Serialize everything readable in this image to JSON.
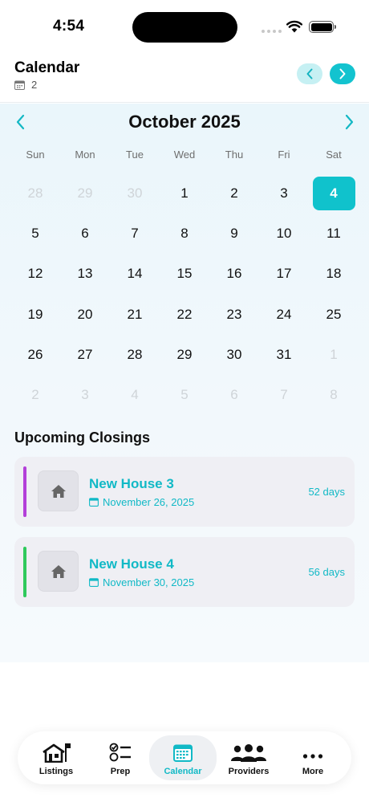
{
  "status_bar": {
    "time": "4:54"
  },
  "header": {
    "title": "Calendar",
    "count": "2"
  },
  "calendar": {
    "month_title": "October 2025",
    "weekdays": [
      "Sun",
      "Mon",
      "Tue",
      "Wed",
      "Thu",
      "Fri",
      "Sat"
    ],
    "selected_day": "4",
    "weeks": [
      [
        {
          "d": "28",
          "out": true
        },
        {
          "d": "29",
          "out": true
        },
        {
          "d": "30",
          "out": true
        },
        {
          "d": "1"
        },
        {
          "d": "2"
        },
        {
          "d": "3"
        },
        {
          "d": "4",
          "sel": true
        }
      ],
      [
        {
          "d": "5"
        },
        {
          "d": "6"
        },
        {
          "d": "7"
        },
        {
          "d": "8"
        },
        {
          "d": "9"
        },
        {
          "d": "10"
        },
        {
          "d": "11"
        }
      ],
      [
        {
          "d": "12"
        },
        {
          "d": "13"
        },
        {
          "d": "14"
        },
        {
          "d": "15"
        },
        {
          "d": "16"
        },
        {
          "d": "17"
        },
        {
          "d": "18"
        }
      ],
      [
        {
          "d": "19"
        },
        {
          "d": "20"
        },
        {
          "d": "21"
        },
        {
          "d": "22"
        },
        {
          "d": "23"
        },
        {
          "d": "24"
        },
        {
          "d": "25"
        }
      ],
      [
        {
          "d": "26"
        },
        {
          "d": "27"
        },
        {
          "d": "28"
        },
        {
          "d": "29"
        },
        {
          "d": "30"
        },
        {
          "d": "31"
        },
        {
          "d": "1",
          "out": true
        }
      ],
      [
        {
          "d": "2",
          "out": true
        },
        {
          "d": "3",
          "out": true
        },
        {
          "d": "4",
          "out": true
        },
        {
          "d": "5",
          "out": true
        },
        {
          "d": "6",
          "out": true
        },
        {
          "d": "7",
          "out": true
        },
        {
          "d": "8",
          "out": true
        }
      ]
    ]
  },
  "upcoming": {
    "title": "Upcoming Closings",
    "items": [
      {
        "name": "New House 3",
        "date": "November 26, 2025",
        "days": "52 days",
        "accent": "#b33fd9"
      },
      {
        "name": "New House 4",
        "date": "November 30, 2025",
        "days": "56 days",
        "accent": "#2fc95c"
      }
    ]
  },
  "tabs": [
    {
      "label": "Listings",
      "icon": "house-flag-icon"
    },
    {
      "label": "Prep",
      "icon": "checklist-icon"
    },
    {
      "label": "Calendar",
      "icon": "calendar-icon",
      "active": true
    },
    {
      "label": "Providers",
      "icon": "people-icon"
    },
    {
      "label": "More",
      "icon": "ellipsis-icon"
    }
  ],
  "colors": {
    "accent": "#11b9c6",
    "selected_day_bg": "#10c2cc"
  }
}
